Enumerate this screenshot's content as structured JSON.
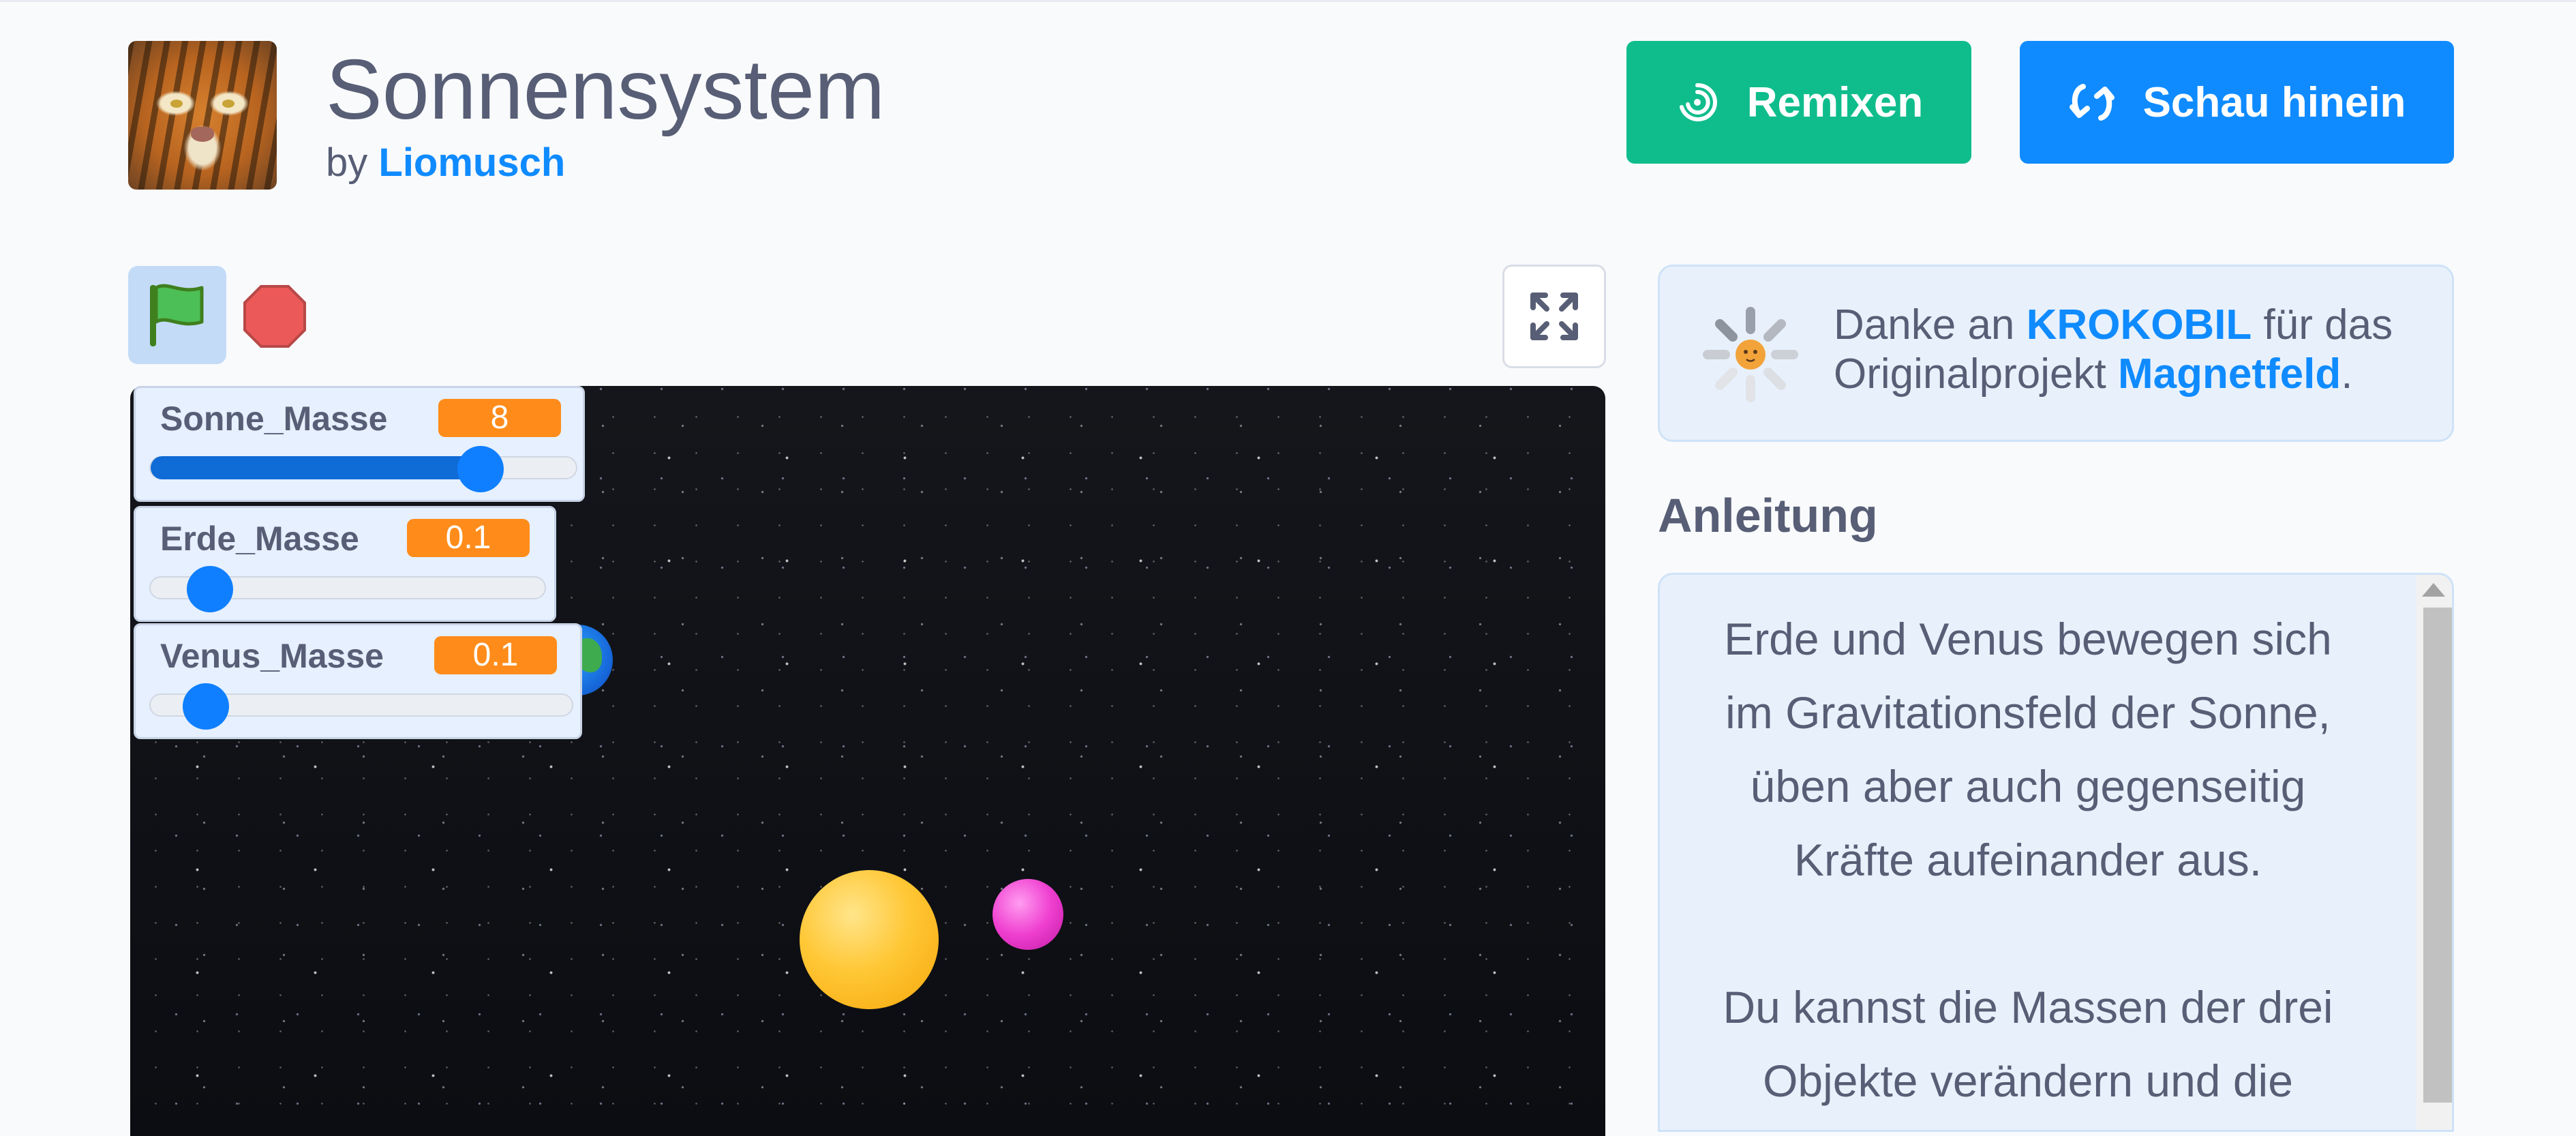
{
  "project": {
    "title": "Sonnensystem",
    "by_prefix": "by",
    "author": "Liomusch"
  },
  "actions": {
    "remix_label": "Remixen",
    "see_inside_label": "Schau hinein"
  },
  "monitors": [
    {
      "label": "Sonne_Masse",
      "value": "8",
      "slider_fraction": 0.77
    },
    {
      "label": "Erde_Masse",
      "value": "0.1",
      "slider_fraction": 0.15
    },
    {
      "label": "Venus_Masse",
      "value": "0.1",
      "slider_fraction": 0.13
    }
  ],
  "credit": {
    "prefix": "Danke an",
    "user": "KROKOBIL",
    "middle": "für das",
    "line2_prefix": "Originalprojekt",
    "project": "Magnetfeld",
    "suffix": "."
  },
  "instructions": {
    "heading": "Anleitung",
    "para1_lines": [
      "Erde und Venus bewegen sich",
      "im Gravitationsfeld der Sonne,",
      "üben aber auch gegenseitig",
      "Kräfte aufeinander aus."
    ],
    "para2_lines": [
      "Du kannst die Massen der drei",
      "Objekte verändern und die"
    ]
  },
  "colors": {
    "remix": "#0fbd8c",
    "see_inside": "#0f8bff",
    "monitor_value": "#ff8c1a",
    "link": "#0f8bff"
  },
  "icons": [
    "remix-icon",
    "see-inside-icon",
    "green-flag-icon",
    "stop-icon",
    "fullscreen-icon",
    "loading-spinner-icon"
  ]
}
